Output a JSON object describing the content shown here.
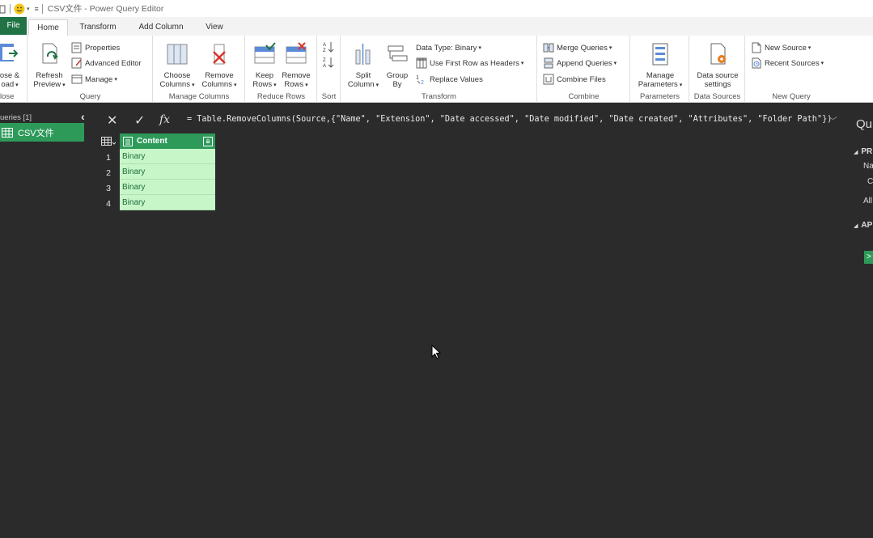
{
  "window": {
    "title": "CSV文件 - Power Query Editor"
  },
  "tabs": {
    "file": "File",
    "home": "Home",
    "transform": "Transform",
    "add_column": "Add Column",
    "view": "View"
  },
  "ribbon": {
    "close": {
      "btn_line1": "ose &",
      "btn_line2": "oad",
      "label": "lose"
    },
    "query": {
      "refresh_line1": "Refresh",
      "refresh_line2": "Preview",
      "properties": "Properties",
      "advanced_editor": "Advanced Editor",
      "manage": "Manage",
      "label": "Query"
    },
    "manage_columns": {
      "choose_line1": "Choose",
      "choose_line2": "Columns",
      "remove_line1": "Remove",
      "remove_line2": "Columns",
      "label": "Manage Columns"
    },
    "reduce_rows": {
      "keep_line1": "Keep",
      "keep_line2": "Rows",
      "remove_line1": "Remove",
      "remove_line2": "Rows",
      "label": "Reduce Rows"
    },
    "sort": {
      "label": "Sort"
    },
    "transform": {
      "split_line1": "Split",
      "split_line2": "Column",
      "group_line1": "Group",
      "group_line2": "By",
      "data_type": "Data Type: Binary",
      "first_row_headers": "Use First Row as Headers",
      "replace_values": "Replace Values",
      "label": "Transform"
    },
    "combine": {
      "merge": "Merge Queries",
      "append": "Append Queries",
      "combine_files": "Combine Files",
      "label": "Combine"
    },
    "parameters": {
      "manage_line1": "Manage",
      "manage_line2": "Parameters",
      "label": "Parameters"
    },
    "data_sources": {
      "settings_line1": "Data source",
      "settings_line2": "settings",
      "label": "Data Sources"
    },
    "new_query": {
      "new_source": "New Source",
      "recent_sources": "Recent Sources",
      "label": "New Query"
    }
  },
  "queries_pane": {
    "header": "ueries [1]",
    "items": [
      {
        "label": "CSV文件"
      }
    ]
  },
  "formula_bar": {
    "fx": "fx",
    "formula": "= Table.RemoveColumns(Source,{\"Name\", \"Extension\", \"Date accessed\", \"Date modified\", \"Date created\", \"Attributes\", \"Folder Path\"})"
  },
  "grid": {
    "column_header": "Content",
    "rows": [
      {
        "num": "1",
        "value": "Binary"
      },
      {
        "num": "2",
        "value": "Binary"
      },
      {
        "num": "3",
        "value": "Binary"
      },
      {
        "num": "4",
        "value": "Binary"
      }
    ]
  },
  "settings_pane": {
    "title": "Qu",
    "section1": "PR",
    "name_label": "Na",
    "name_value": "C",
    "all_props": "All",
    "section2": "AP"
  },
  "colors": {
    "accent_green": "#217346",
    "selected_green": "#2e9a5a",
    "cell_green": "#c7f7c9",
    "dark_bg": "#2b2b2b"
  }
}
